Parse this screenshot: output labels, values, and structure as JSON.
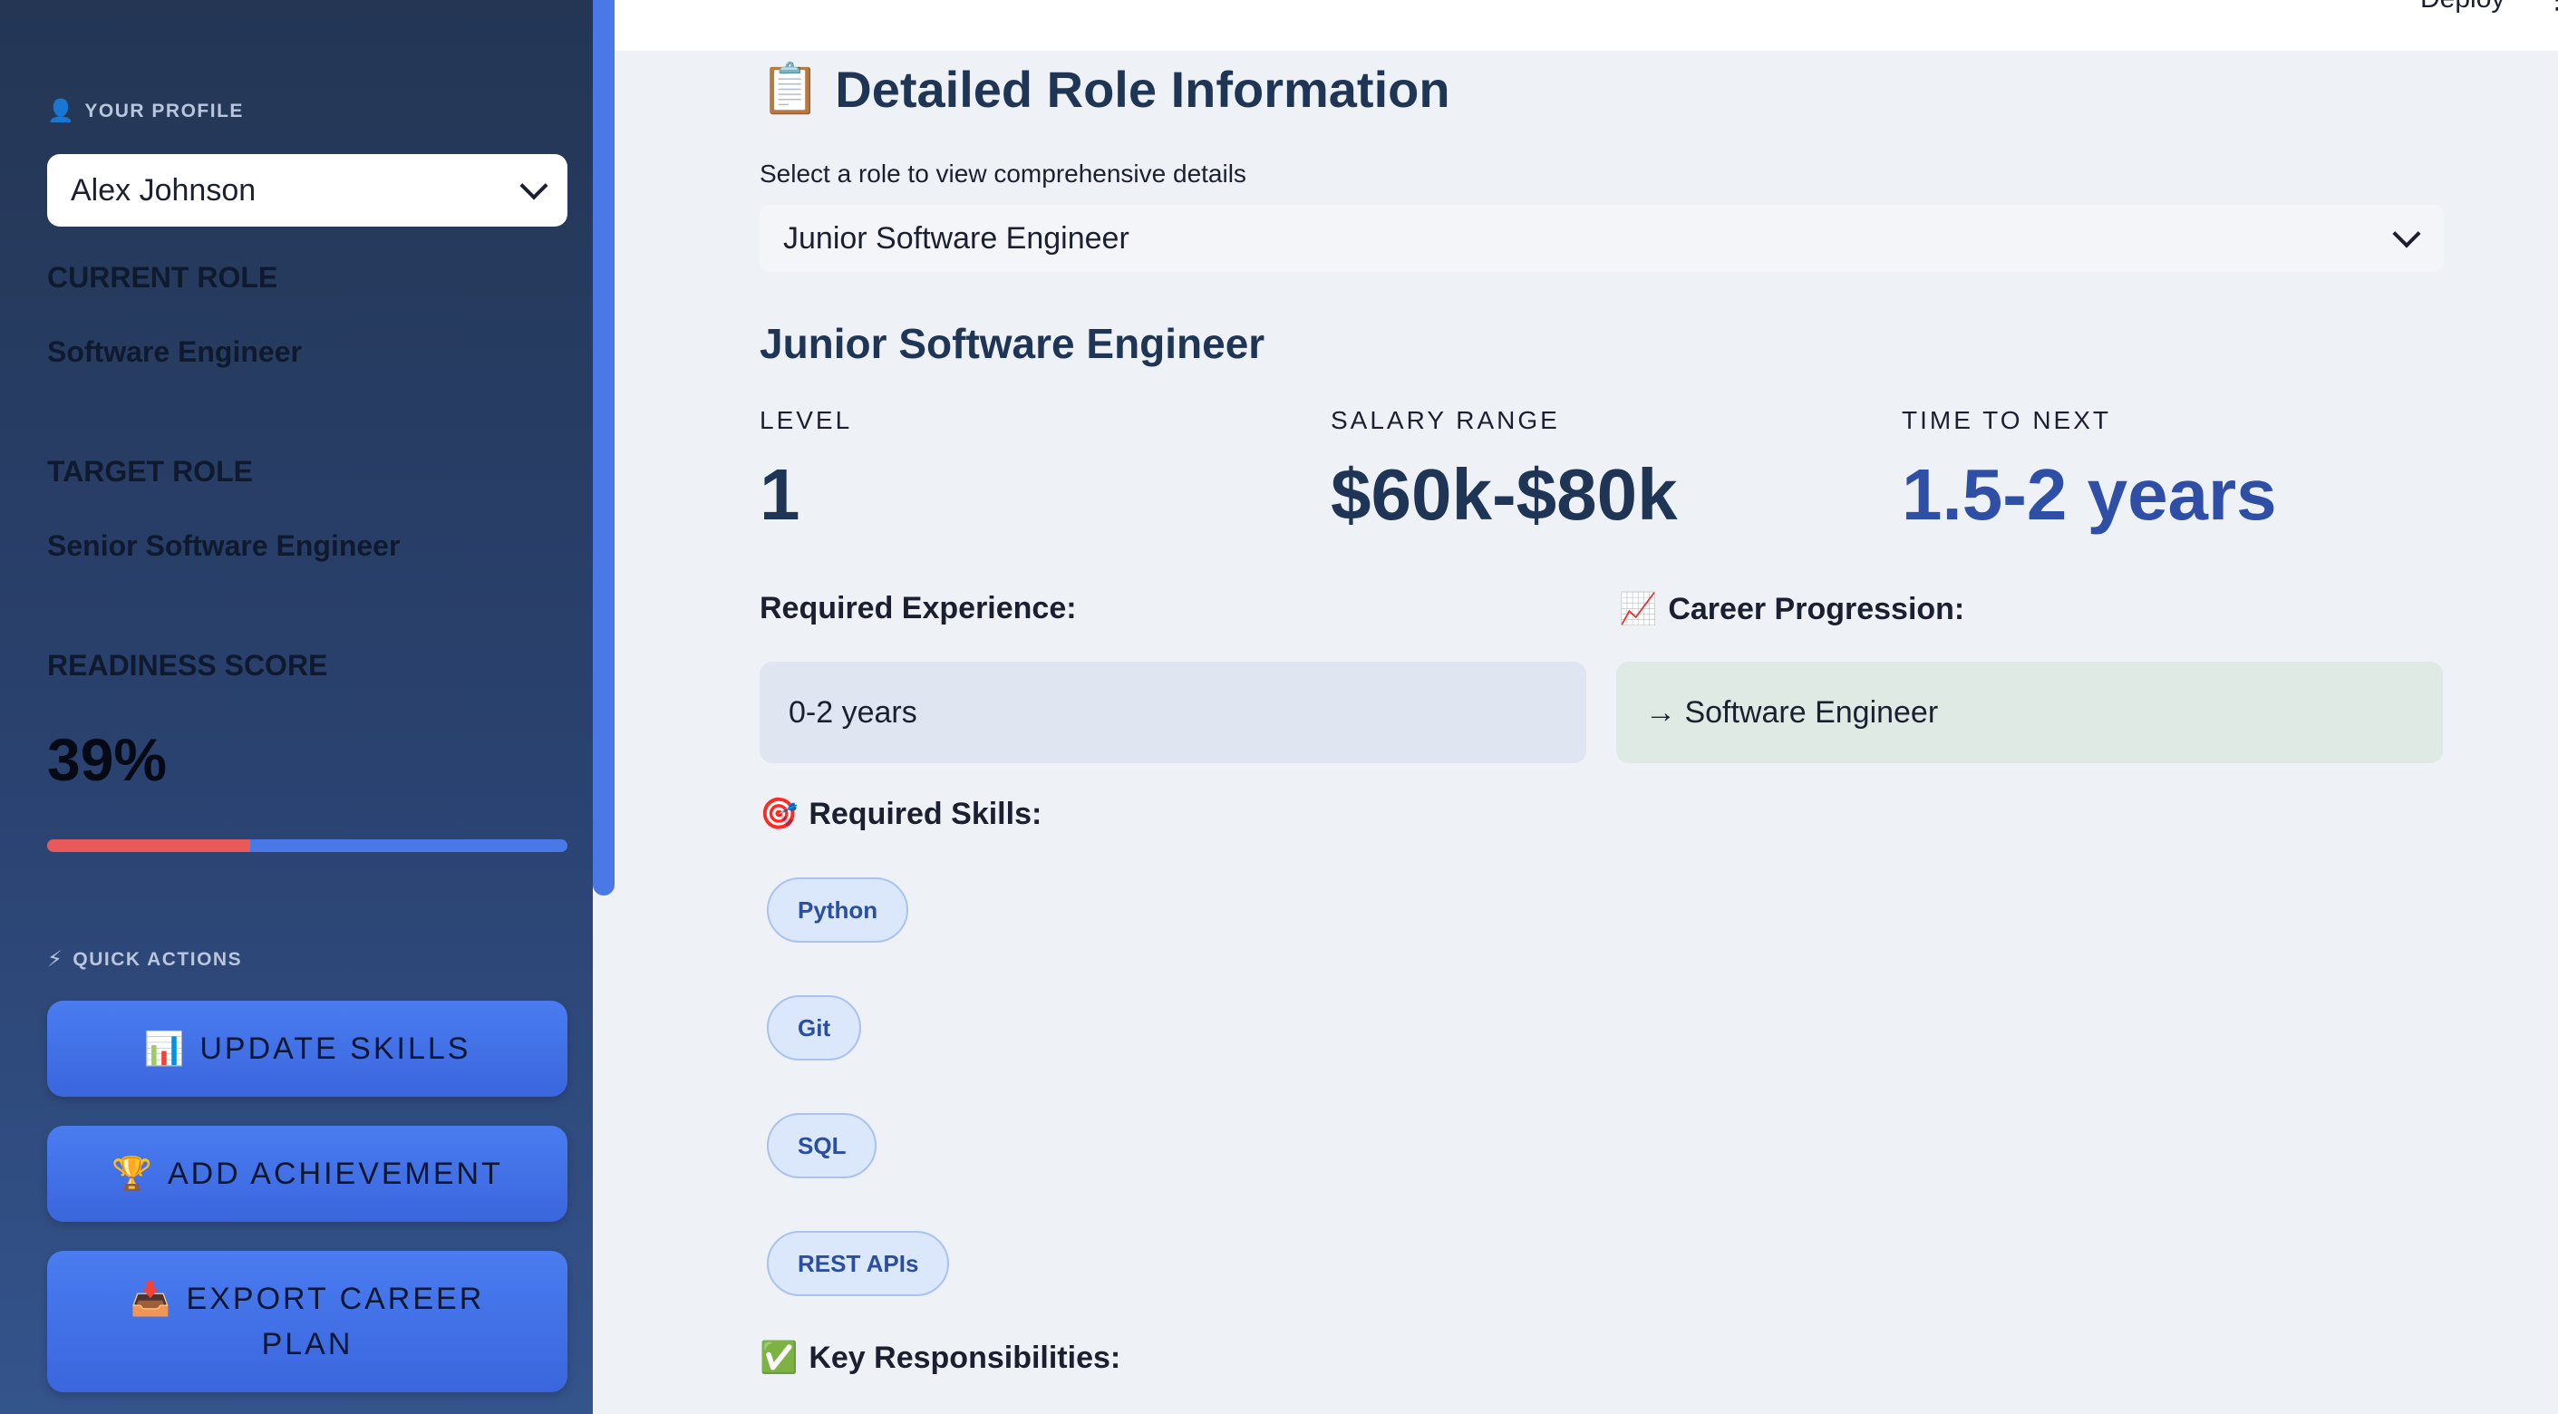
{
  "topbar": {
    "deploy_label": "Deploy",
    "menu_label": "⋮"
  },
  "sidebar": {
    "profile_heading_icon": "person-icon",
    "profile_heading": "YOUR PROFILE",
    "profile_select_value": "Alex Johnson",
    "current_role_label": "CURRENT ROLE",
    "current_role_value": "Software Engineer",
    "target_role_label": "TARGET ROLE",
    "target_role_value": "Senior Software Engineer",
    "readiness_label": "READINESS SCORE",
    "readiness_value": "39%",
    "readiness_fraction": 0.39,
    "quick_actions_heading": "QUICK ACTIONS",
    "quick_actions_icon": "lightning-icon",
    "buttons": {
      "update_skills": {
        "icon": "📊",
        "label": "UPDATE SKILLS"
      },
      "add_achievement": {
        "icon": "🏆",
        "label": "ADD ACHIEVEMENT"
      },
      "export_plan": {
        "icon": "📥",
        "label_line1": "EXPORT CAREER",
        "label_line2": "PLAN"
      }
    }
  },
  "main": {
    "title_icon": "📋",
    "title": "Detailed Role Information",
    "select_label": "Select a role to view comprehensive details",
    "select_value": "Junior Software Engineer",
    "role_heading": "Junior Software Engineer",
    "metrics": {
      "level_label": "LEVEL",
      "level_value": "1",
      "salary_label": "SALARY RANGE",
      "salary_value": "$60k-$80k",
      "time_label": "TIME TO NEXT",
      "time_value": "1.5-2 years"
    },
    "experience_heading": "Required Experience:",
    "experience_value": "0-2 years",
    "progression_icon": "📈",
    "progression_heading": "Career Progression:",
    "progression_value": "→ Software Engineer",
    "skills_icon": "🎯",
    "skills_heading": "Required Skills:",
    "skills": [
      "Python",
      "Git",
      "SQL",
      "REST APIs"
    ],
    "responsibilities_icon": "✅",
    "responsibilities_heading": "Key Responsibilities:"
  },
  "colors": {
    "sidebar_bg": "#2a4270",
    "accent_blue": "#4a78e6",
    "progress_red": "#e85a5a",
    "heading_navy": "#1f3556",
    "chip_bg": "#dbe7fb"
  }
}
